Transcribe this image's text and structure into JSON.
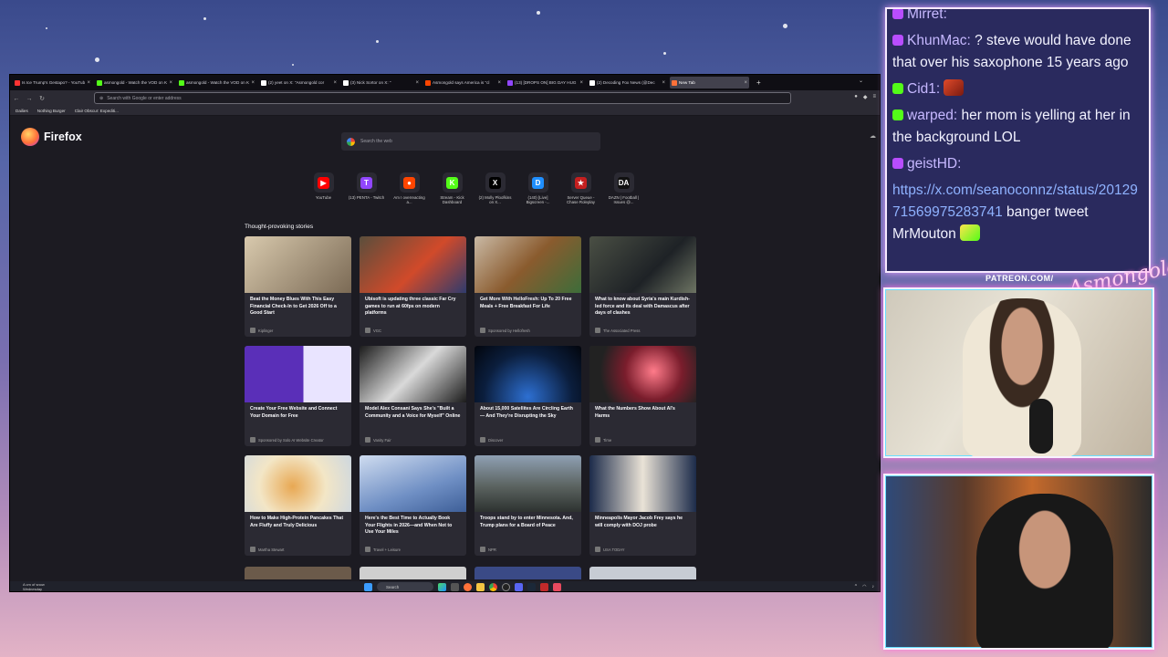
{
  "browser": {
    "tabs": [
      {
        "title": "Is Ice Trump's Gestapo? - YouTube",
        "color": "#ff3333"
      },
      {
        "title": "asmongold - Watch the VOD on Kick",
        "color": "#53fc18"
      },
      {
        "title": "asmongold - Watch the VOD on Kick",
        "color": "#53fc18"
      },
      {
        "title": "(2) yeet on X: \"Asmongold cor",
        "color": "#ffffff"
      },
      {
        "title": "(3) Nick Sortor on X: \"",
        "color": "#ffffff"
      },
      {
        "title": "Asmongold says America is \"cl",
        "color": "#ff4500"
      },
      {
        "title": "(13) [DROPS ON] BIG DAY HUG",
        "color": "#9146ff"
      },
      {
        "title": "(2) Decoding Fox News (@Dec",
        "color": "#ffffff"
      },
      {
        "title": "New Tab",
        "color": "#ff7139"
      }
    ],
    "address_placeholder": "Search with Google or enter address",
    "bookmarks": [
      "Dailies",
      "Nothing Burger",
      "Clair Obscur: Expediti..."
    ],
    "brand": "Firefox",
    "search_placeholder": "Search the web",
    "shortcuts": [
      {
        "label": "YouTube",
        "icon": "youtube-icon",
        "color": "#ff0000",
        "glyph": "▶"
      },
      {
        "label": "(13) PENTA - Twitch",
        "icon": "twitch-icon",
        "color": "#9146ff",
        "glyph": "T"
      },
      {
        "label": "Am I overreacting a...",
        "icon": "reddit-icon",
        "color": "#ff4500",
        "glyph": "●"
      },
      {
        "label": "Stream - Kick Dashboard",
        "icon": "kick-icon",
        "color": "#53fc18",
        "glyph": "K"
      },
      {
        "label": "(2) Molly Ploofkins on X...",
        "icon": "x-icon",
        "color": "#000000",
        "glyph": "X"
      },
      {
        "label": "(140) [Live] Bigscreen -...",
        "icon": "bigscreen-icon",
        "color": "#1f8fff",
        "glyph": "D"
      },
      {
        "label": "Server Queue - Chase Roleplay",
        "icon": "chase-rp-icon",
        "color": "#c41f1f",
        "glyph": "★"
      },
      {
        "label": "DAZN | Football | Issues @...",
        "icon": "dazn-icon",
        "color": "#111111",
        "glyph": "DA"
      }
    ],
    "stories_heading": "Thought-provoking stories",
    "stories": [
      {
        "title": "Beat the Money Blues With This Easy Financial Check-In to Get 2026 Off to a Good Start",
        "source": "Kiplinger",
        "img": "linear-gradient(135deg,#d8c9ad,#7b6a55)"
      },
      {
        "title": "Ubisoft is updating three classic Far Cry games to run at 60fps on modern platforms",
        "source": "VGC",
        "img": "linear-gradient(135deg,#5a4e3c,#d14a2a 55%,#2f3b6d)"
      },
      {
        "title": "Get More With HelloFresh: Up To 20 Free Meals + Free Breakfast For Life",
        "source": "Sponsored by Hellofresh",
        "img": "linear-gradient(135deg,#c9b9a5,#8a5b2e 50%,#3d6d3a)"
      },
      {
        "title": "What to know about Syria's main Kurdish-led force and its deal with Damascus after days of clashes",
        "source": "The Associated Press",
        "img": "linear-gradient(135deg,#4a4f44,#1e2226 60%,#6d7463)"
      },
      {
        "title": "Create Your Free Website and Connect Your Domain for Free",
        "source": "Sponsored by Solo AI Website Creator",
        "img": "linear-gradient(90deg,#5a2fb8 55%,#e9e4ff 55%)"
      },
      {
        "title": "Model Alex Consani Says She's \"Built a Community and a Voice for Myself\" Online",
        "source": "Vanity Fair",
        "img": "linear-gradient(135deg,#1b1b1b,#d9d9d9 50%,#1b1b1b)"
      },
      {
        "title": "About 15,000 Satellites Are Circling Earth — And They're Disrupting the Sky",
        "source": "Discover",
        "img": "radial-gradient(circle at 50% 90%,#2d6fd1,#0b1e3d 60%,#02050c)"
      },
      {
        "title": "What the Numbers Show About AI's Harms",
        "source": "Time",
        "img": "radial-gradient(circle at 60% 45%,#ff7b8a,#7a1d2c 40%,#222 75%)"
      },
      {
        "title": "How to Make High-Protein Pancakes That Are Fluffy and Truly Delicious",
        "source": "Martha Stewart",
        "img": "radial-gradient(circle at 45% 55%,#e8a853,#f3e6c6 50%,#cdd7e0)"
      },
      {
        "title": "Here's the Best Time to Actually Book Your Flights in 2026—and When Not to Use Your Miles",
        "source": "Travel + Leisure",
        "img": "linear-gradient(160deg,#cfdcf0,#6f8fc4 60%,#3e5f98)"
      },
      {
        "title": "Troops stand by to enter Minnesota. And, Trump plans for a Board of Peace",
        "source": "NPR",
        "img": "linear-gradient(180deg,#8fa0b3,#5b6360 55%,#2d3230)"
      },
      {
        "title": "Minneapolis Mayor Jacob Frey says he will comply with DOJ probe",
        "source": "USA TODAY",
        "img": "linear-gradient(90deg,#1c2b4a,#e9e2d6 50%,#1c2b4a)"
      }
    ],
    "taskbar": {
      "weather_line1": "A cm of snow",
      "weather_line2": "Wednesday",
      "search_label": "Search"
    }
  },
  "chat": {
    "top_user": "Mirret:",
    "messages": [
      {
        "user": "KhunMac:",
        "text": "? steve would have done that over his saxophone 15 years ago",
        "badge_color": "#b84dff"
      },
      {
        "user": "Cid1:",
        "text": "",
        "badge_color": "#53fc18",
        "emote": true
      },
      {
        "user": "warped:",
        "text": "her mom is yelling at her in the background LOL",
        "badge_color": "#53fc18"
      },
      {
        "user": "geistHD:",
        "text": "",
        "badge_color": "#b84dff"
      }
    ],
    "link": "https://x.com/seanoconnz/status/2012971569975283741",
    "link_tail": "banger tweet MrMouton"
  },
  "overlay": {
    "patreon": "PATREON.COM/",
    "signature": "Asmongold"
  }
}
